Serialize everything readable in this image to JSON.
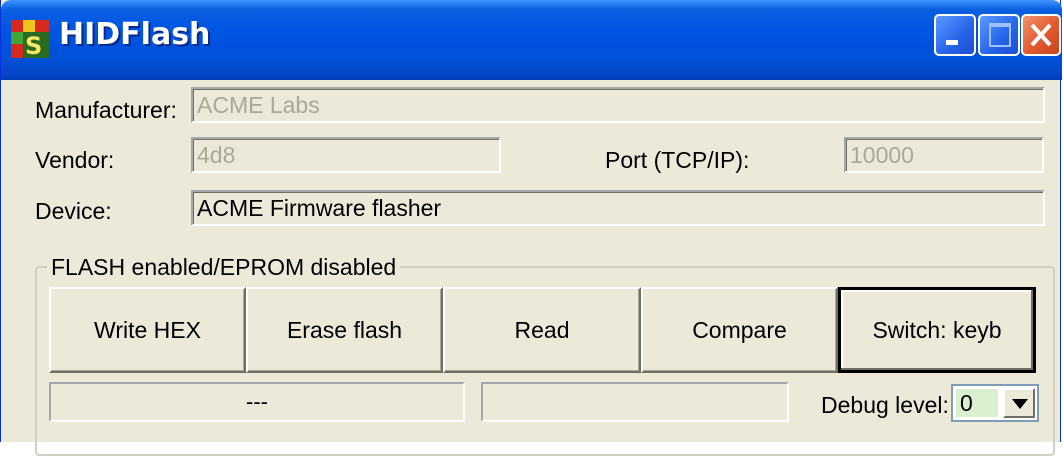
{
  "window": {
    "title": "HIDFlash",
    "icon": "hidflash-app-icon",
    "controls": [
      "minimize-icon",
      "maximize-icon",
      "close-icon"
    ]
  },
  "form": {
    "manufacturer_label": "Manufacturer:",
    "manufacturer_value": "ACME Labs",
    "vendor_label": "Vendor:",
    "vendor_value": "4d8",
    "port_label": "Port (TCP/IP):",
    "port_value": "10000",
    "device_label": "Device:",
    "device_value": "ACME Firmware flasher"
  },
  "group": {
    "title": "FLASH enabled/EPROM disabled",
    "buttons": [
      "Write HEX",
      "Erase flash",
      "Read",
      "Compare",
      "Switch: keyb"
    ]
  },
  "status": {
    "left_text": "---",
    "middle_text": "",
    "debug_label": "Debug level:",
    "debug_value": "0"
  },
  "colors": {
    "titlebar": "#0054e3",
    "face": "#ece9d8",
    "close_button": "#e2592f",
    "disabled_text": "#aca899"
  }
}
